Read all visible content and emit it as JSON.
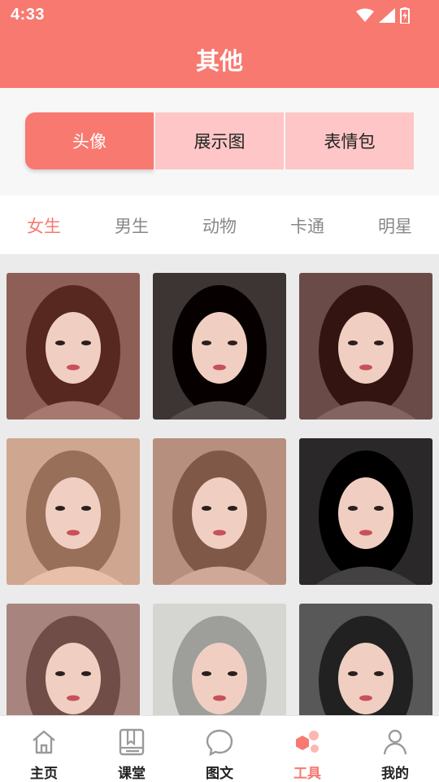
{
  "status_bar": {
    "time": "4:33"
  },
  "header": {
    "title": "其他"
  },
  "segments": [
    {
      "label": "头像",
      "active": true
    },
    {
      "label": "展示图",
      "active": false
    },
    {
      "label": "表情包",
      "active": false
    }
  ],
  "categories": [
    {
      "label": "女生",
      "active": true
    },
    {
      "label": "男生",
      "active": false
    },
    {
      "label": "动物",
      "active": false
    },
    {
      "label": "卡通",
      "active": false
    },
    {
      "label": "明星",
      "active": false
    }
  ],
  "gallery": {
    "items": [
      {
        "name": "avatar-photo-1",
        "tone": "#8d5f56"
      },
      {
        "name": "avatar-photo-2",
        "tone": "#3d3434"
      },
      {
        "name": "avatar-photo-3",
        "tone": "#6a4b48"
      },
      {
        "name": "avatar-photo-4",
        "tone": "#cfa68f"
      },
      {
        "name": "avatar-photo-5",
        "tone": "#b68f7f"
      },
      {
        "name": "avatar-photo-6",
        "tone": "#2b2829"
      },
      {
        "name": "avatar-photo-7",
        "tone": "#a8847e"
      },
      {
        "name": "avatar-photo-8",
        "tone": "#d5d5d2"
      },
      {
        "name": "avatar-photo-9",
        "tone": "#585858"
      }
    ]
  },
  "bottom_nav": [
    {
      "label": "主页",
      "icon": "home-icon",
      "active": false
    },
    {
      "label": "课堂",
      "icon": "book-icon",
      "active": false
    },
    {
      "label": "图文",
      "icon": "chat-bubble-icon",
      "active": false
    },
    {
      "label": "工具",
      "icon": "tools-icon",
      "active": true
    },
    {
      "label": "我的",
      "icon": "user-icon",
      "active": false
    }
  ],
  "colors": {
    "accent": "#f87970",
    "segment_inactive": "#fec6c6",
    "category_inactive": "#888888"
  }
}
